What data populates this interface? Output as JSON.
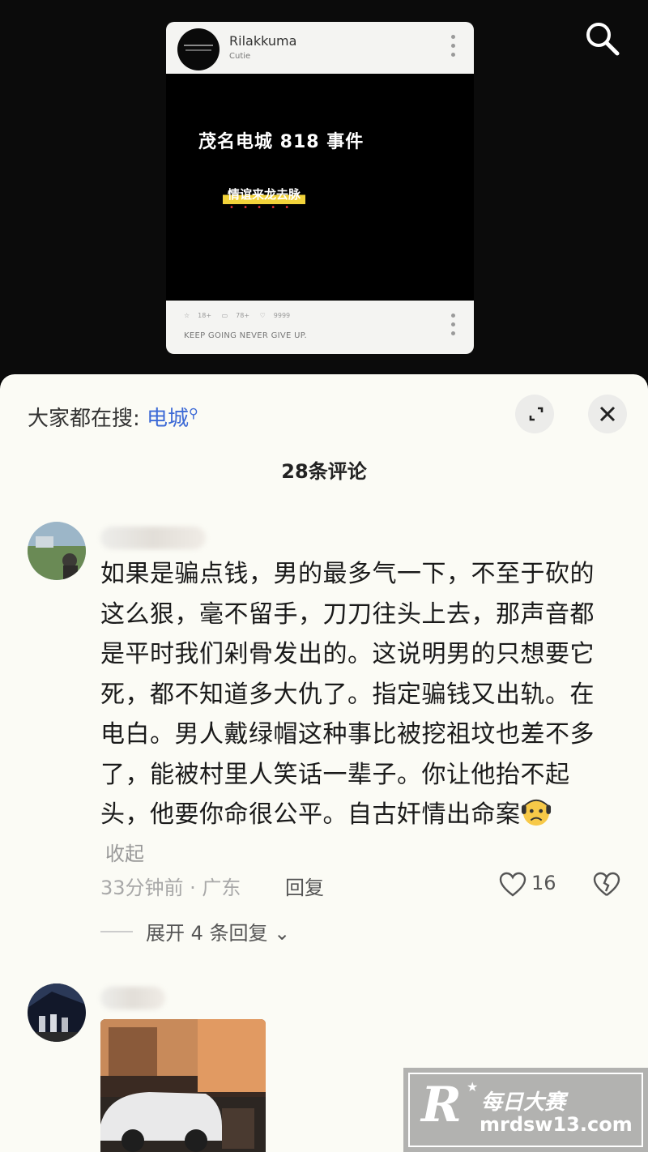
{
  "post": {
    "account_name": "Rilakkuma",
    "account_sub": "Cutie",
    "video_title": "茂名电城 818 事件",
    "tag": "情谊来龙去脉",
    "stats": [
      "18+",
      "78+",
      "9999"
    ],
    "motto": "KEEP GOING NEVER GIVE UP."
  },
  "icons": {
    "search": "search-icon",
    "expand": "expand-icon",
    "close": "close-icon"
  },
  "sheet": {
    "hot_search_prefix": "大家都在搜:",
    "hot_search_keyword": "电城",
    "comment_count_label": "28条评论"
  },
  "comments": [
    {
      "text": "如果是骗点钱，男的最多气一下，不至于砍的这么狠，毫不留手，刀刀往头上去，那声音都是平时我们剁骨发出的。这说明男的只想要它死，都不知道多大仇了。指定骗钱又出轨。在电白。男人戴绿帽这种事比被挖祖坟也差不多了，能被村里人笑话一辈子。你让他抬不起头，他要你命很公平。自古奸情出命案",
      "collapse_label": "收起",
      "meta": "33分钟前 · 广东",
      "reply_label": "回复",
      "likes": "16",
      "expand_label": "展开 4 条回复"
    }
  ],
  "watermark": {
    "logo_letter": "R",
    "name": "每日大赛",
    "url": "mrdsw13.com"
  }
}
